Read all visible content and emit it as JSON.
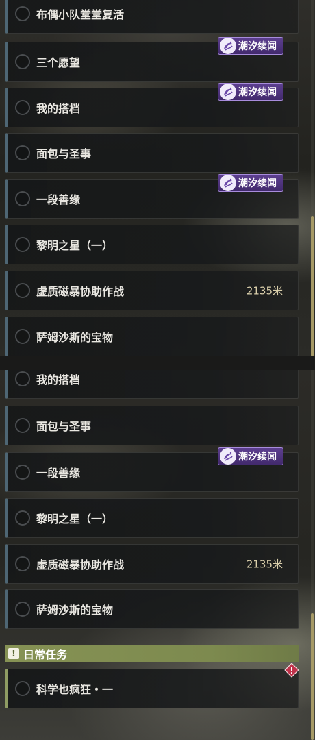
{
  "tag_label": "潮汐续闻",
  "top_list": [
    {
      "label": "布偶小队堂堂复活",
      "tag": false,
      "distance": ""
    },
    {
      "label": "三个愿望",
      "tag": true,
      "distance": ""
    },
    {
      "label": "我的搭档",
      "tag": true,
      "distance": ""
    },
    {
      "label": "面包与圣事",
      "tag": false,
      "distance": ""
    },
    {
      "label": "一段善缘",
      "tag": true,
      "distance": ""
    },
    {
      "label": "黎明之星（一）",
      "tag": false,
      "distance": ""
    },
    {
      "label": "虚质磁暴协助作战",
      "tag": false,
      "distance": "2135米"
    },
    {
      "label": "萨姆沙斯的宝物",
      "tag": false,
      "distance": ""
    }
  ],
  "bottom_list": [
    {
      "label": "我的搭档",
      "tag": true,
      "distance": ""
    },
    {
      "label": "面包与圣事",
      "tag": false,
      "distance": ""
    },
    {
      "label": "一段善缘",
      "tag": true,
      "distance": ""
    },
    {
      "label": "黎明之星（一）",
      "tag": false,
      "distance": ""
    },
    {
      "label": "虚质磁暴协助作战",
      "tag": false,
      "distance": "2135米"
    },
    {
      "label": "萨姆沙斯的宝物",
      "tag": false,
      "distance": ""
    }
  ],
  "daily_section": {
    "title": "日常任务",
    "icon": "exclamation-icon",
    "items": [
      {
        "label": "科学也疯狂・一",
        "badge": "warning-diamond-icon"
      }
    ]
  },
  "colors": {
    "tag_purple": "#5d3f90",
    "quest_accent": "#4e6674",
    "daily_accent": "#869254",
    "distance_gold": "#d9ceaa",
    "scroll_thumb": "#a69a67",
    "warning_red": "#c0324a"
  }
}
